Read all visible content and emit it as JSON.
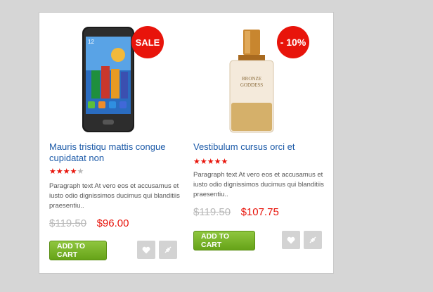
{
  "products": [
    {
      "image": "smartphone product image",
      "badge": "SALE",
      "title": "Mauris tristiqu mattis congue cupidatat non",
      "rating": 4,
      "max_rating": 5,
      "description": "Paragraph text At vero eos et accusamus et iusto odio dignissimos ducimus qui blanditiis praesentiu..",
      "old_price": "$119.50",
      "new_price": "$96.00",
      "cart_label": "ADD TO CART",
      "wishlist_icon": "heart-icon",
      "compare_icon": "compare-arrows-icon"
    },
    {
      "image": "perfume bottle product image",
      "badge": "- 10%",
      "title": "Vestibulum cursus orci et",
      "rating": 5,
      "max_rating": 5,
      "description": "Paragraph text At vero eos et accusamus et iusto odio dignissimos ducimus qui blanditiis praesentiu..",
      "old_price": "$119.50",
      "new_price": "$107.75",
      "cart_label": "ADD TO CART",
      "wishlist_icon": "heart-icon",
      "compare_icon": "compare-arrows-icon"
    }
  ],
  "colors": {
    "badge_red": "#e8140b",
    "price_red": "#e8140b",
    "title_blue": "#1c5aa8",
    "cart_green": "#7ab82a"
  }
}
